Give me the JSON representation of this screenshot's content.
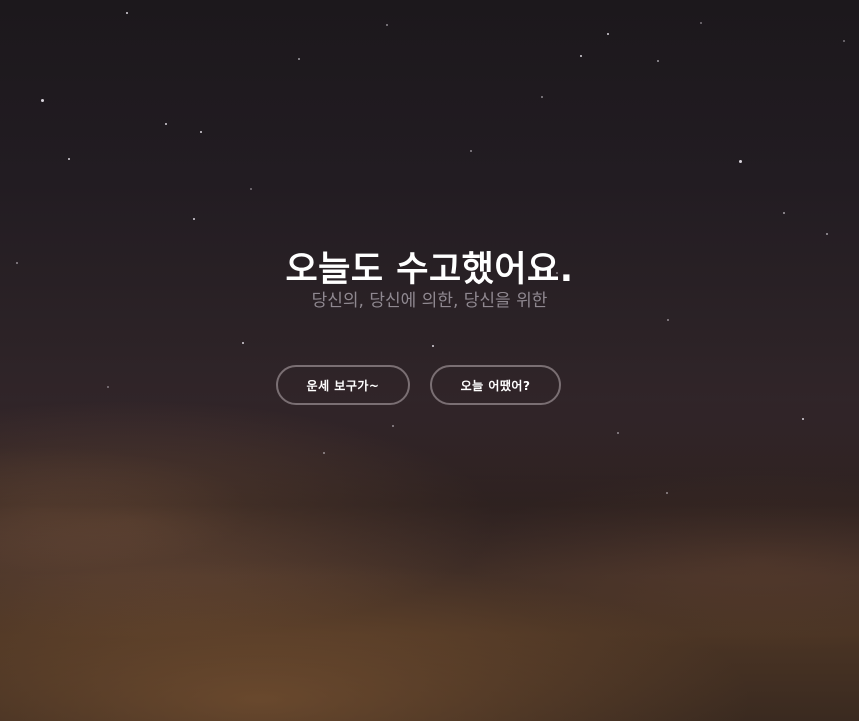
{
  "hero": {
    "title": "오늘도 수고했어요.",
    "subtitle": "당신의, 당신에 의한, 당신을 위한"
  },
  "actions": {
    "fortune_label": "운세 보구가~",
    "today_label": "오늘 어땠어?"
  },
  "colors": {
    "title": "#ffffff",
    "subtitle": "#8f8890",
    "button_border": "#7a6f73",
    "sky_top": "#1c181c",
    "horizon_glow": "#8c5f37"
  }
}
